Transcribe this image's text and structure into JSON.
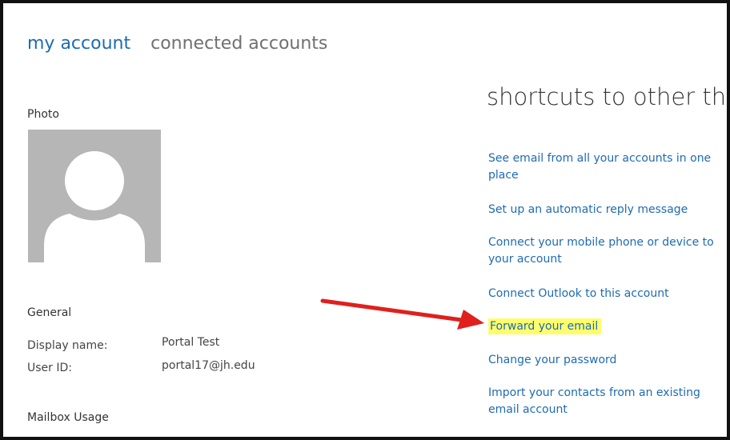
{
  "tabs": {
    "my_account": "my account",
    "connected_accounts": "connected accounts"
  },
  "left": {
    "photo_label": "Photo",
    "general_heading": "General",
    "display_name_label": "Display name:",
    "display_name_value": "Portal Test",
    "user_id_label": "User ID:",
    "user_id_value": "portal17@jh.edu",
    "mailbox_usage_heading": "Mailbox Usage"
  },
  "shortcuts": {
    "title": "shortcuts to other thin..",
    "items": [
      "See email from all your accounts in one place",
      "Set up an automatic reply message",
      "Connect your mobile phone or device to your account",
      "Connect Outlook to this account",
      "Forward your email",
      "Change your password",
      "Import your contacts from an existing email account"
    ]
  },
  "colors": {
    "link": "#1e6bb2",
    "highlight": "#fdfd6e",
    "annotation_arrow": "#e0201c"
  },
  "icons": {
    "photo": "user-silhouette-icon",
    "annotation": "red-arrow-icon"
  }
}
